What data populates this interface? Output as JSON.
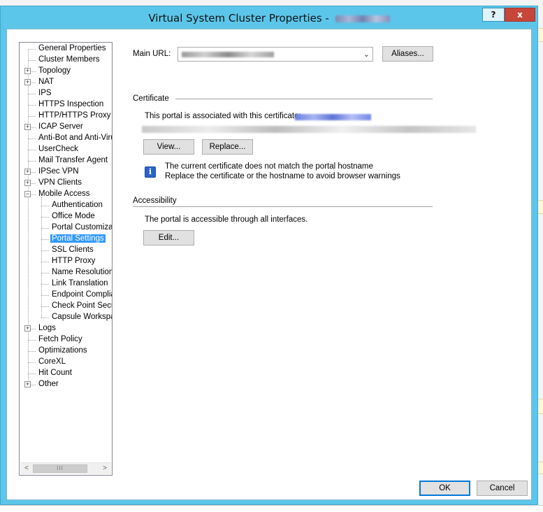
{
  "window": {
    "title": "Virtual System Cluster Properties - ",
    "help_label": "?",
    "close_label": "x"
  },
  "tree": {
    "items": [
      {
        "label": "General Properties"
      },
      {
        "label": "Cluster Members"
      },
      {
        "label": "Topology"
      },
      {
        "label": "NAT"
      },
      {
        "label": "IPS"
      },
      {
        "label": "HTTPS Inspection"
      },
      {
        "label": "HTTP/HTTPS Proxy"
      },
      {
        "label": "ICAP Server"
      },
      {
        "label": "Anti-Bot and Anti-Virus"
      },
      {
        "label": "UserCheck"
      },
      {
        "label": "Mail Transfer Agent"
      },
      {
        "label": "IPSec VPN"
      },
      {
        "label": "VPN Clients"
      },
      {
        "label": "Mobile Access"
      },
      {
        "label": "Authentication"
      },
      {
        "label": "Office Mode"
      },
      {
        "label": "Portal Customization"
      },
      {
        "label": "Portal Settings"
      },
      {
        "label": "SSL Clients"
      },
      {
        "label": "HTTP Proxy"
      },
      {
        "label": "Name Resolution"
      },
      {
        "label": "Link Translation"
      },
      {
        "label": "Endpoint Compliance"
      },
      {
        "label": "Check Point Secure Workspace"
      },
      {
        "label": "Capsule Workspace"
      },
      {
        "label": "Logs"
      },
      {
        "label": "Fetch Policy"
      },
      {
        "label": "Optimizations"
      },
      {
        "label": "CoreXL"
      },
      {
        "label": "Hit Count"
      },
      {
        "label": "Other"
      }
    ],
    "selected": "Portal Settings",
    "scroll_left_glyph": "<",
    "scroll_right_glyph": ">",
    "thumb_grip": "III"
  },
  "main_url": {
    "label": "Main URL:",
    "aliases_button": "Aliases..."
  },
  "certificate": {
    "section_title": "Certificate",
    "associated_text": "This portal is associated with this certificate:",
    "view_button": "View...",
    "replace_button": "Replace...",
    "info_icon_glyph": "i",
    "warning_line1": "The current certificate does not match the portal hostname",
    "warning_line2": "Replace the certificate or the hostname to avoid browser warnings"
  },
  "accessibility": {
    "section_title": "Accessibility",
    "description": "The portal is accessible through all interfaces.",
    "edit_button": "Edit..."
  },
  "footer": {
    "ok_button": "OK",
    "cancel_button": "Cancel"
  },
  "colors": {
    "title_bar": "#5cc6ea",
    "selection": "#3399ff",
    "close_button": "#c7463a"
  }
}
